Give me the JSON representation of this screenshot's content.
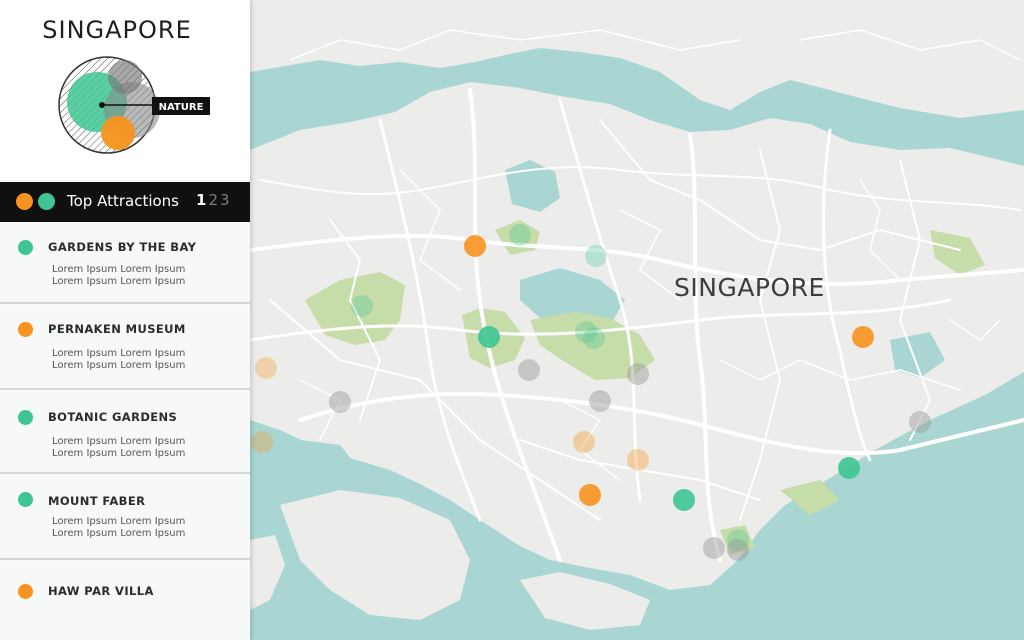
{
  "brand": {
    "title": "SINGAPORE",
    "emblem_label": "NATURE"
  },
  "header": {
    "title": "Top Attractions",
    "pages": [
      "1",
      "2",
      "3"
    ],
    "active_page": "1"
  },
  "attractions": [
    {
      "name": "GARDENS BY THE BAY",
      "desc1": "Lorem Ipsum Lorem Ipsum",
      "desc2": "Lorem Ipsum Lorem Ipsum",
      "category": "teal"
    },
    {
      "name": "PERNAKEN MUSEUM",
      "desc1": "Lorem Ipsum Lorem Ipsum",
      "desc2": "Lorem Ipsum Lorem Ipsum",
      "category": "orange"
    },
    {
      "name": "BOTANIC GARDENS",
      "desc1": "Lorem Ipsum Lorem Ipsum",
      "desc2": "Lorem Ipsum Lorem Ipsum",
      "category": "teal"
    },
    {
      "name": "MOUNT FABER",
      "desc1": "Lorem Ipsum Lorem Ipsum",
      "desc2": "Lorem Ipsum Lorem Ipsum",
      "category": "teal"
    },
    {
      "name": "HAW PAR VILLA",
      "desc1": "",
      "desc2": "",
      "category": "orange"
    }
  ],
  "map": {
    "label": "SINGAPORE"
  },
  "colors": {
    "orange": "#f7931e",
    "teal": "#3ec592",
    "gray": "#9a9a9a",
    "water": "#a9d6d3",
    "land": "#ececea",
    "park": "#c6dca9",
    "road": "#ffffff"
  }
}
